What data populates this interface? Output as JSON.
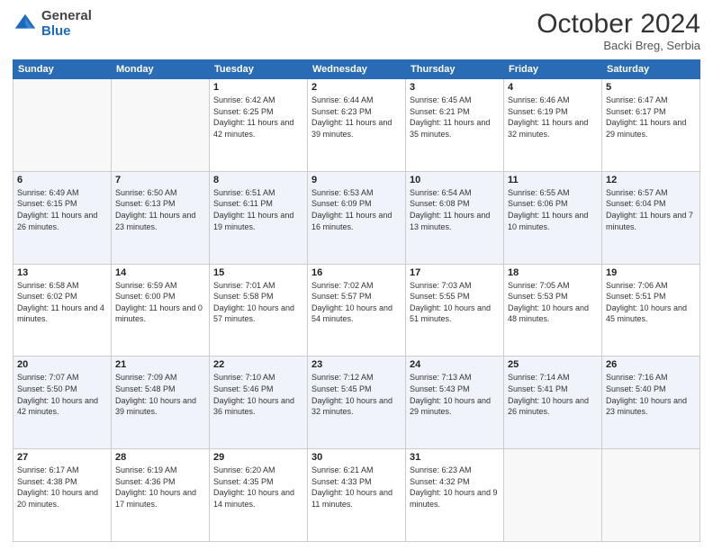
{
  "header": {
    "logo_general": "General",
    "logo_blue": "Blue",
    "month_title": "October 2024",
    "location": "Backi Breg, Serbia"
  },
  "days_of_week": [
    "Sunday",
    "Monday",
    "Tuesday",
    "Wednesday",
    "Thursday",
    "Friday",
    "Saturday"
  ],
  "weeks": [
    [
      {
        "day": "",
        "info": ""
      },
      {
        "day": "",
        "info": ""
      },
      {
        "day": "1",
        "info": "Sunrise: 6:42 AM\nSunset: 6:25 PM\nDaylight: 11 hours and 42 minutes."
      },
      {
        "day": "2",
        "info": "Sunrise: 6:44 AM\nSunset: 6:23 PM\nDaylight: 11 hours and 39 minutes."
      },
      {
        "day": "3",
        "info": "Sunrise: 6:45 AM\nSunset: 6:21 PM\nDaylight: 11 hours and 35 minutes."
      },
      {
        "day": "4",
        "info": "Sunrise: 6:46 AM\nSunset: 6:19 PM\nDaylight: 11 hours and 32 minutes."
      },
      {
        "day": "5",
        "info": "Sunrise: 6:47 AM\nSunset: 6:17 PM\nDaylight: 11 hours and 29 minutes."
      }
    ],
    [
      {
        "day": "6",
        "info": "Sunrise: 6:49 AM\nSunset: 6:15 PM\nDaylight: 11 hours and 26 minutes."
      },
      {
        "day": "7",
        "info": "Sunrise: 6:50 AM\nSunset: 6:13 PM\nDaylight: 11 hours and 23 minutes."
      },
      {
        "day": "8",
        "info": "Sunrise: 6:51 AM\nSunset: 6:11 PM\nDaylight: 11 hours and 19 minutes."
      },
      {
        "day": "9",
        "info": "Sunrise: 6:53 AM\nSunset: 6:09 PM\nDaylight: 11 hours and 16 minutes."
      },
      {
        "day": "10",
        "info": "Sunrise: 6:54 AM\nSunset: 6:08 PM\nDaylight: 11 hours and 13 minutes."
      },
      {
        "day": "11",
        "info": "Sunrise: 6:55 AM\nSunset: 6:06 PM\nDaylight: 11 hours and 10 minutes."
      },
      {
        "day": "12",
        "info": "Sunrise: 6:57 AM\nSunset: 6:04 PM\nDaylight: 11 hours and 7 minutes."
      }
    ],
    [
      {
        "day": "13",
        "info": "Sunrise: 6:58 AM\nSunset: 6:02 PM\nDaylight: 11 hours and 4 minutes."
      },
      {
        "day": "14",
        "info": "Sunrise: 6:59 AM\nSunset: 6:00 PM\nDaylight: 11 hours and 0 minutes."
      },
      {
        "day": "15",
        "info": "Sunrise: 7:01 AM\nSunset: 5:58 PM\nDaylight: 10 hours and 57 minutes."
      },
      {
        "day": "16",
        "info": "Sunrise: 7:02 AM\nSunset: 5:57 PM\nDaylight: 10 hours and 54 minutes."
      },
      {
        "day": "17",
        "info": "Sunrise: 7:03 AM\nSunset: 5:55 PM\nDaylight: 10 hours and 51 minutes."
      },
      {
        "day": "18",
        "info": "Sunrise: 7:05 AM\nSunset: 5:53 PM\nDaylight: 10 hours and 48 minutes."
      },
      {
        "day": "19",
        "info": "Sunrise: 7:06 AM\nSunset: 5:51 PM\nDaylight: 10 hours and 45 minutes."
      }
    ],
    [
      {
        "day": "20",
        "info": "Sunrise: 7:07 AM\nSunset: 5:50 PM\nDaylight: 10 hours and 42 minutes."
      },
      {
        "day": "21",
        "info": "Sunrise: 7:09 AM\nSunset: 5:48 PM\nDaylight: 10 hours and 39 minutes."
      },
      {
        "day": "22",
        "info": "Sunrise: 7:10 AM\nSunset: 5:46 PM\nDaylight: 10 hours and 36 minutes."
      },
      {
        "day": "23",
        "info": "Sunrise: 7:12 AM\nSunset: 5:45 PM\nDaylight: 10 hours and 32 minutes."
      },
      {
        "day": "24",
        "info": "Sunrise: 7:13 AM\nSunset: 5:43 PM\nDaylight: 10 hours and 29 minutes."
      },
      {
        "day": "25",
        "info": "Sunrise: 7:14 AM\nSunset: 5:41 PM\nDaylight: 10 hours and 26 minutes."
      },
      {
        "day": "26",
        "info": "Sunrise: 7:16 AM\nSunset: 5:40 PM\nDaylight: 10 hours and 23 minutes."
      }
    ],
    [
      {
        "day": "27",
        "info": "Sunrise: 6:17 AM\nSunset: 4:38 PM\nDaylight: 10 hours and 20 minutes."
      },
      {
        "day": "28",
        "info": "Sunrise: 6:19 AM\nSunset: 4:36 PM\nDaylight: 10 hours and 17 minutes."
      },
      {
        "day": "29",
        "info": "Sunrise: 6:20 AM\nSunset: 4:35 PM\nDaylight: 10 hours and 14 minutes."
      },
      {
        "day": "30",
        "info": "Sunrise: 6:21 AM\nSunset: 4:33 PM\nDaylight: 10 hours and 11 minutes."
      },
      {
        "day": "31",
        "info": "Sunrise: 6:23 AM\nSunset: 4:32 PM\nDaylight: 10 hours and 9 minutes."
      },
      {
        "day": "",
        "info": ""
      },
      {
        "day": "",
        "info": ""
      }
    ]
  ]
}
